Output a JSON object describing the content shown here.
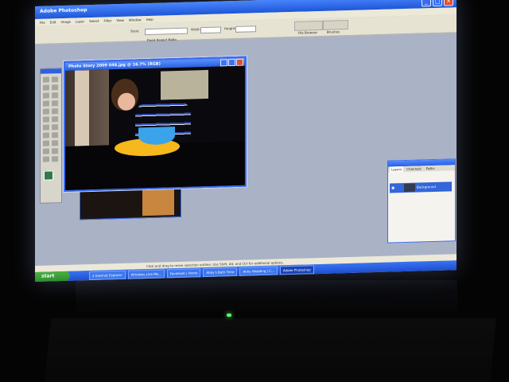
{
  "app": {
    "title": "Adobe Photoshop"
  },
  "menubar": {
    "items": [
      "File",
      "Edit",
      "Image",
      "Layer",
      "Select",
      "Filter",
      "View",
      "Window",
      "Help"
    ]
  },
  "options": {
    "style_label": "Style:",
    "style_value": "Fixed Aspect Ratio",
    "width_label": "Width:",
    "height_label": "Height:",
    "palette_well": [
      "File Browser",
      "Brushes"
    ]
  },
  "document": {
    "title": "Photo Story 2009 048.jpg @ 16.7% (RGB)"
  },
  "layers_palette": {
    "tabs": [
      "Layers",
      "Channels",
      "Paths"
    ],
    "active_tab": "Layers",
    "layer_name": "Background"
  },
  "status": {
    "text": "Click and drag to move selection outline. Use Shift, Alt, and Ctrl for additional options."
  },
  "taskbar": {
    "start_label": "start",
    "tasks": [
      {
        "label": "2 Internet Explorer",
        "active": false
      },
      {
        "label": "Windows Live Me...",
        "active": false
      },
      {
        "label": "Facebook | Home",
        "active": false
      },
      {
        "label": "Abby's Bath Time",
        "active": false
      },
      {
        "label": "Abby Wedding | C...",
        "active": false
      },
      {
        "label": "Adobe Photoshop",
        "active": true
      }
    ]
  }
}
